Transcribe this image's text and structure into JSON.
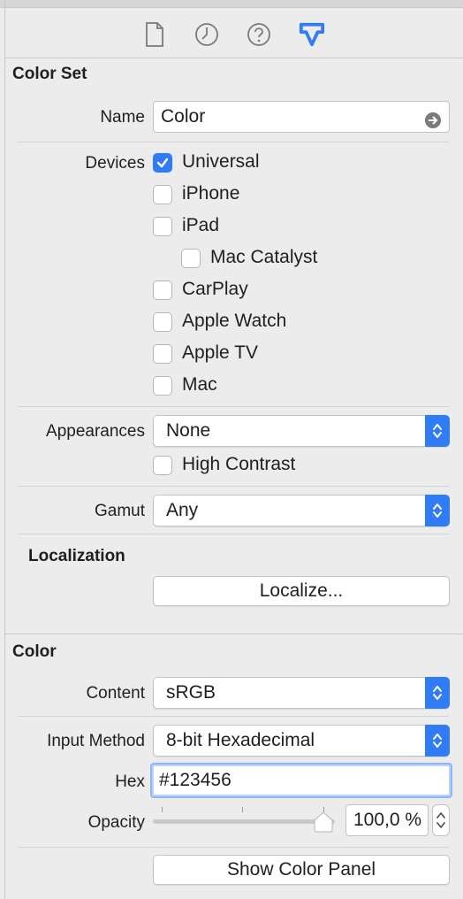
{
  "tabs": {
    "file_icon": "file-icon",
    "history_icon": "clock-icon",
    "help_icon": "question-icon",
    "attributes_icon": "attributes-inspector-icon"
  },
  "color_set": {
    "title": "Color Set",
    "name_label": "Name",
    "name_value": "Color",
    "devices_label": "Devices",
    "devices": [
      {
        "label": "Universal",
        "checked": true
      },
      {
        "label": "iPhone",
        "checked": false
      },
      {
        "label": "iPad",
        "checked": false
      },
      {
        "label": "Mac Catalyst",
        "checked": false
      },
      {
        "label": "CarPlay",
        "checked": false
      },
      {
        "label": "Apple Watch",
        "checked": false
      },
      {
        "label": "Apple TV",
        "checked": false
      },
      {
        "label": "Mac",
        "checked": false
      }
    ],
    "appearances_label": "Appearances",
    "appearances_value": "None",
    "high_contrast_label": "High Contrast",
    "gamut_label": "Gamut",
    "gamut_value": "Any",
    "localization_title": "Localization",
    "localize_button": "Localize..."
  },
  "color": {
    "title": "Color",
    "content_label": "Content",
    "content_value": "sRGB",
    "input_method_label": "Input Method",
    "input_method_value": "8-bit Hexadecimal",
    "hex_label": "Hex",
    "hex_value": "#123456",
    "opacity_label": "Opacity",
    "opacity_value": "100,0 %",
    "opacity_level": 1.0,
    "show_color_panel_button": "Show Color Panel"
  },
  "accent_color": "#2f7cf6"
}
